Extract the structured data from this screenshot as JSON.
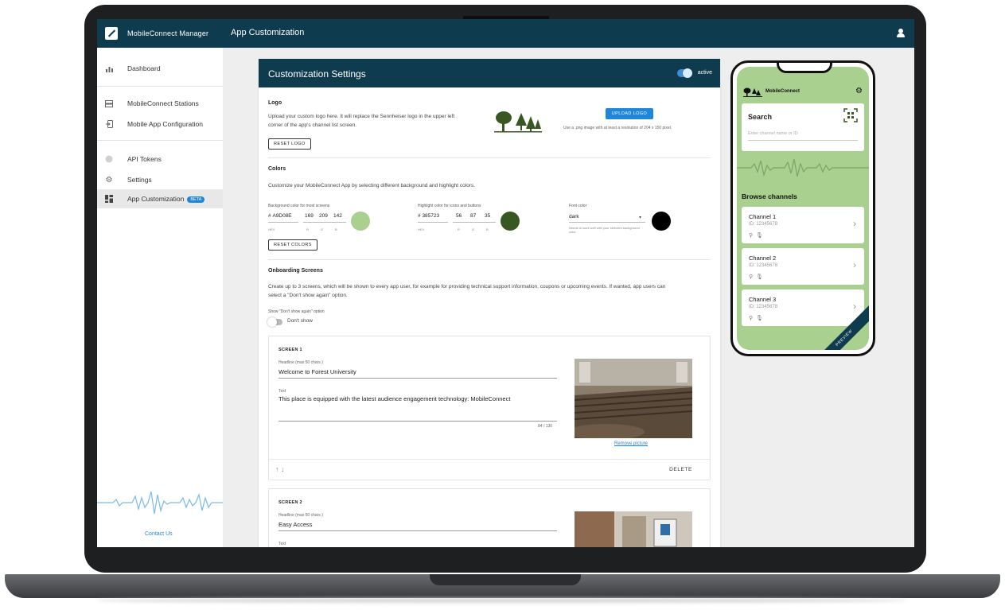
{
  "app": {
    "brand": "MobileConnect Manager",
    "page_title": "App Customization"
  },
  "sidebar": {
    "items": [
      {
        "label": "Dashboard",
        "icon": "bar-chart-icon"
      },
      {
        "label": "MobileConnect Stations",
        "icon": "server-icon"
      },
      {
        "label": "Mobile App Configuration",
        "icon": "phone-config-icon"
      },
      {
        "label": "API Tokens",
        "icon": "globe-icon"
      },
      {
        "label": "Settings",
        "icon": "gear-icon"
      },
      {
        "label": "App Customization",
        "icon": "dashboard-grid-icon",
        "badge": "BETA",
        "active": true
      }
    ],
    "contact": "Contact Us"
  },
  "card": {
    "title": "Customization Settings",
    "toggle_label": "active",
    "toggle_on": true
  },
  "logo_section": {
    "title": "Logo",
    "description_line1": "Upload your custom logo here. It will replace the Sennheiser logo in the upper left",
    "description_line2": "corner of the app's channel list screen.",
    "reset_label": "RESET LOGO",
    "upload_label": "UPLOAD LOGO",
    "upload_hint": "Use a .png image with at least a resolution of 204 x 150 pixel."
  },
  "colors_section": {
    "title": "Colors",
    "description": "Customize your MobileConnect App by selecting different background and highlight colors.",
    "background": {
      "label": "Background color for most screens",
      "hex": "A9D08E",
      "r": "169",
      "g": "209",
      "b": "142",
      "swatch": "#A9D08E"
    },
    "highlight": {
      "label": "Highlight color for icons and buttons",
      "hex": "385723",
      "r": "56",
      "g": "87",
      "b": "35",
      "swatch": "#385723"
    },
    "font": {
      "label": "Font color",
      "value": "dark",
      "note": "Needs to work well with your selected background color.",
      "swatch": "#000000"
    },
    "hex_prefix": "#",
    "sub_hex": "HEX",
    "sub_r": "R",
    "sub_g": "G",
    "sub_b": "B",
    "reset_label": "RESET COLORS"
  },
  "onboarding_section": {
    "title": "Onboarding Screens",
    "description_line1": "Create up to 3 screens, which will be shown to every app user, for example for providing technical support information, coupons or upcoming events. If wanted, app users can",
    "description_line2": "select a \"Don't show again\" option.",
    "option_label": "Show \"Don't show again\" option",
    "toggle_label": "Don't show",
    "toggle_on": false
  },
  "screens": [
    {
      "title": "SCREEN 1",
      "headline_label": "Headline (max 50 chars.)",
      "headline": "Welcome to Forest University",
      "text_label": "Text",
      "text": "This place is equipped with the latest audience engagement technology: MobileConnect",
      "count": "84 / 130",
      "remove_label": "Remove picture",
      "delete_label": "DELETE"
    },
    {
      "title": "SCREEN 2",
      "headline_label": "Headline (max 50 chars.)",
      "headline": "Easy Access",
      "text_label": "Text"
    }
  ],
  "phone": {
    "brand": "MobileConnect",
    "search_title": "Search",
    "search_placeholder": "Enter channel name or ID",
    "browse_title": "Browse channels",
    "channels": [
      {
        "name": "Channel 1",
        "id": "ID: 12345678"
      },
      {
        "name": "Channel 2",
        "id": "ID: 12345678"
      },
      {
        "name": "Channel 3",
        "id": "ID: 12345678"
      }
    ],
    "ribbon": "PREVIEW"
  },
  "colors": {
    "primary_dark": "#0F3B4F",
    "accent_blue": "#1F86D9"
  }
}
